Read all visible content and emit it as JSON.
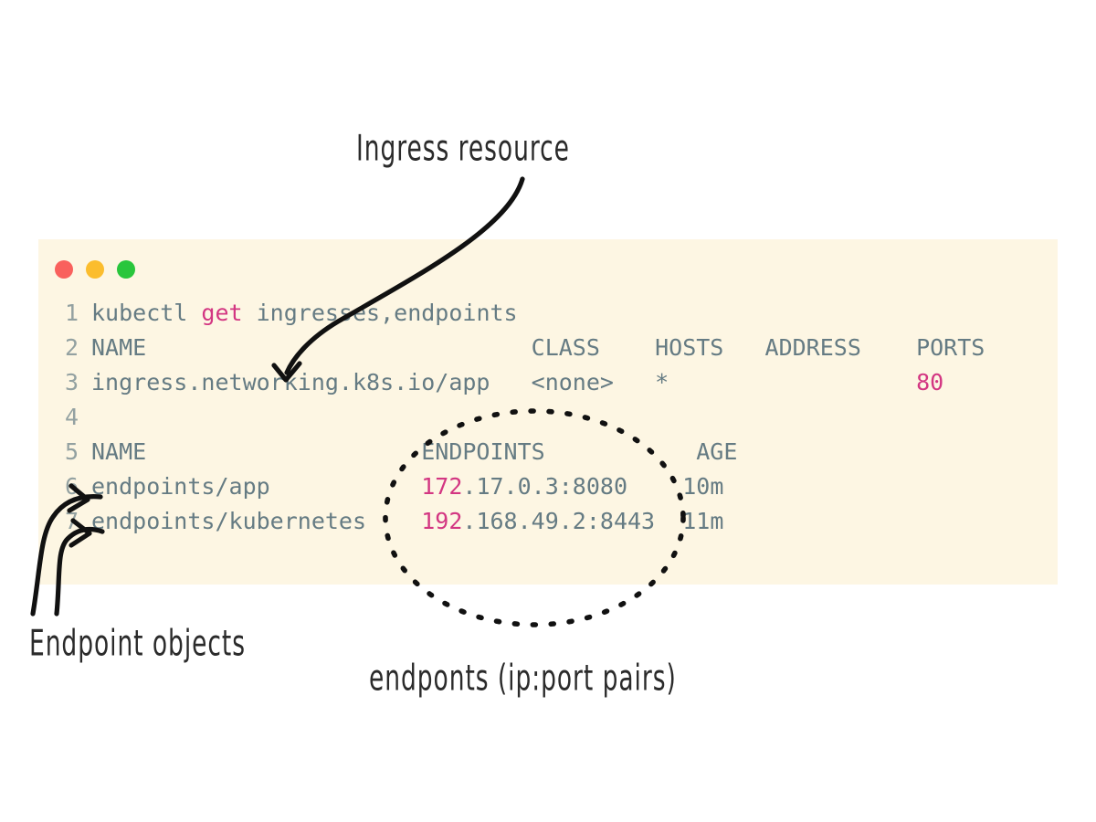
{
  "window": {
    "name": "terminal-window",
    "background": "#fdf6e3",
    "traffic_lights": [
      {
        "name": "close",
        "color": "#f9615d"
      },
      {
        "name": "minimize",
        "color": "#fbbd2e"
      },
      {
        "name": "maximize",
        "color": "#29c63c"
      }
    ]
  },
  "colors": {
    "page_background": "#ffffff",
    "terminal_background": "#fdf6e3",
    "text": "#657b83",
    "line_number": "#93a1a1",
    "accent_pink": "#d33682",
    "ink": "#2b2b2b"
  },
  "terminal": {
    "lines": [
      {
        "number": "1",
        "segments": [
          {
            "text": "kubectl ",
            "style": "txt"
          },
          {
            "text": "get",
            "style": "kw"
          },
          {
            "text": " ingresses,endpoints",
            "style": "txt"
          }
        ]
      },
      {
        "number": "2",
        "segments": [
          {
            "text": "NAME                            CLASS    HOSTS   ADDRESS    PORTS",
            "style": "txt"
          }
        ]
      },
      {
        "number": "3",
        "segments": [
          {
            "text": "ingress.networking.k8s.io/app   <none>   *                  ",
            "style": "txt"
          },
          {
            "text": "80",
            "style": "num"
          }
        ]
      },
      {
        "number": "4",
        "segments": [
          {
            "text": "",
            "style": "txt"
          }
        ]
      },
      {
        "number": "5",
        "segments": [
          {
            "text": "NAME                    ENDPOINTS           AGE",
            "style": "txt"
          }
        ]
      },
      {
        "number": "6",
        "segments": [
          {
            "text": "endpoints/app           ",
            "style": "txt"
          },
          {
            "text": "172",
            "style": "num"
          },
          {
            "text": ".17.0.3:8080    10m",
            "style": "txt"
          }
        ]
      },
      {
        "number": "7",
        "segments": [
          {
            "text": "endpoints/kubernetes    ",
            "style": "txt"
          },
          {
            "text": "192",
            "style": "num"
          },
          {
            "text": ".168.49.2:8443  11m",
            "style": "txt"
          }
        ]
      }
    ],
    "command": "kubectl get ingresses,endpoints",
    "ingress_table": {
      "headers": [
        "NAME",
        "CLASS",
        "HOSTS",
        "ADDRESS",
        "PORTS"
      ],
      "rows": [
        {
          "NAME": "ingress.networking.k8s.io/app",
          "CLASS": "<none>",
          "HOSTS": "*",
          "ADDRESS": "",
          "PORTS": "80"
        }
      ]
    },
    "endpoints_table": {
      "headers": [
        "NAME",
        "ENDPOINTS",
        "AGE"
      ],
      "rows": [
        {
          "NAME": "endpoints/app",
          "ENDPOINTS": "172.17.0.3:8080",
          "AGE": "10m"
        },
        {
          "NAME": "endpoints/kubernetes",
          "ENDPOINTS": "192.168.49.2:8443",
          "AGE": "11m"
        }
      ]
    }
  },
  "annotations": {
    "ingress_label": "Ingress resource",
    "endpoint_objects_label": "Endpoint objects",
    "endpoints_pairs_label": "endponts (ip:port pairs)"
  }
}
